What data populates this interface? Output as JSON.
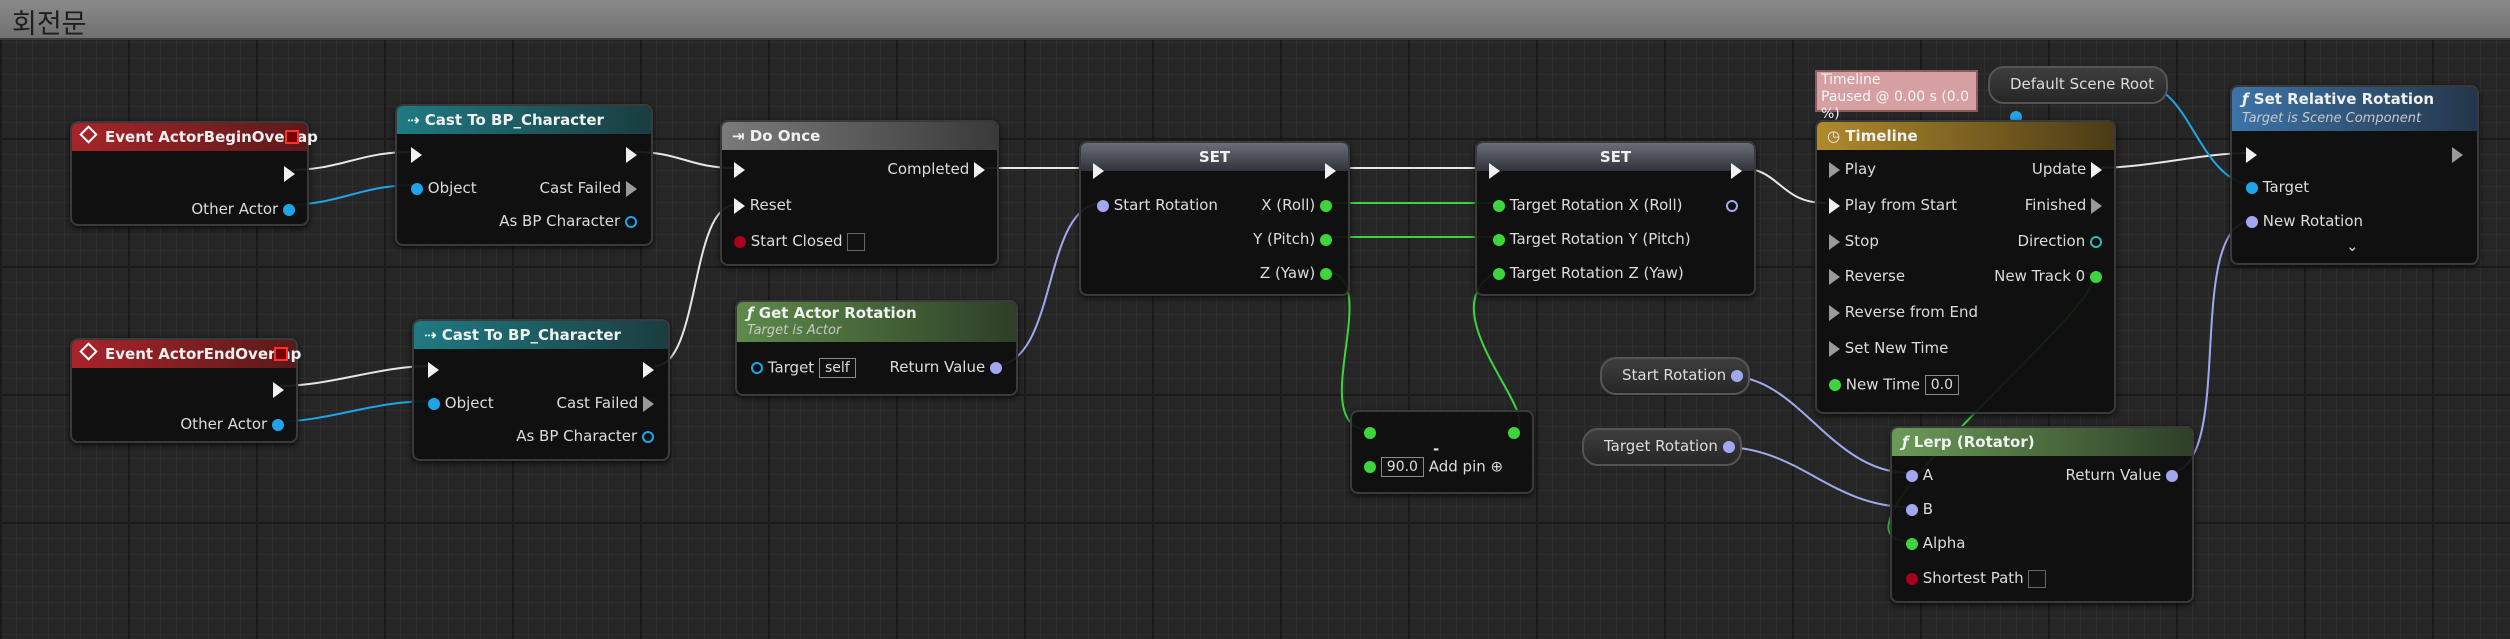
{
  "window": {
    "title": "회전문"
  },
  "colors": {
    "exec": "#f0f0f0",
    "object": "#1fa4e8",
    "rotator": "#a2a8f0",
    "float": "#3ed43e",
    "bool": "#a8001a",
    "event_header": "#a8242a",
    "cast_header": "#1f7a83",
    "function_header": "#5e8a4a"
  },
  "nodes": {
    "begin_overlap": {
      "title": "Event ActorBeginOverlap",
      "other_actor": "Other Actor"
    },
    "end_overlap": {
      "title": "Event ActorEndOverlap",
      "other_actor": "Other Actor"
    },
    "cast1": {
      "title": "Cast To BP_Character",
      "object": "Object",
      "cast_failed": "Cast Failed",
      "as_bp": "As BP Character"
    },
    "cast2": {
      "title": "Cast To BP_Character",
      "object": "Object",
      "cast_failed": "Cast Failed",
      "as_bp": "As BP Character"
    },
    "do_once": {
      "title": "Do Once",
      "completed": "Completed",
      "reset": "Reset",
      "start_closed": "Start Closed"
    },
    "get_actor_rotation": {
      "title": "Get Actor Rotation",
      "subtitle": "Target is Actor",
      "target": "Target",
      "target_value": "self",
      "return_value": "Return Value"
    },
    "set1": {
      "title": "SET",
      "start_rotation": "Start Rotation",
      "x": "X (Roll)",
      "y": "Y (Pitch)",
      "z": "Z (Yaw)"
    },
    "set2": {
      "title": "SET",
      "x": "Target Rotation X (Roll)",
      "y": "Target Rotation Y (Pitch)",
      "z": "Target Rotation Z (Yaw)"
    },
    "add": {
      "op": "-",
      "value": "90.0",
      "add_pin": "Add pin"
    },
    "timeline_comment": {
      "line1": "Timeline",
      "line2": "Paused @ 0.00 s (0.0 %)"
    },
    "default_scene_root": {
      "label": "Default Scene Root"
    },
    "timeline": {
      "title": "Timeline",
      "play": "Play",
      "play_from_start": "Play from Start",
      "stop": "Stop",
      "reverse": "Reverse",
      "reverse_from_end": "Reverse from End",
      "set_new_time": "Set New Time",
      "new_time": "New Time",
      "new_time_value": "0.0",
      "update": "Update",
      "finished": "Finished",
      "direction": "Direction",
      "new_track": "New Track 0"
    },
    "start_rotation_var": {
      "label": "Start Rotation"
    },
    "target_rotation_var": {
      "label": "Target Rotation"
    },
    "lerp": {
      "title": "Lerp (Rotator)",
      "a": "A",
      "b": "B",
      "alpha": "Alpha",
      "shortest_path": "Shortest Path",
      "return_value": "Return Value"
    },
    "set_relative_rotation": {
      "title": "Set Relative Rotation",
      "subtitle": "Target is Scene Component",
      "target": "Target",
      "new_rotation": "New Rotation"
    }
  }
}
